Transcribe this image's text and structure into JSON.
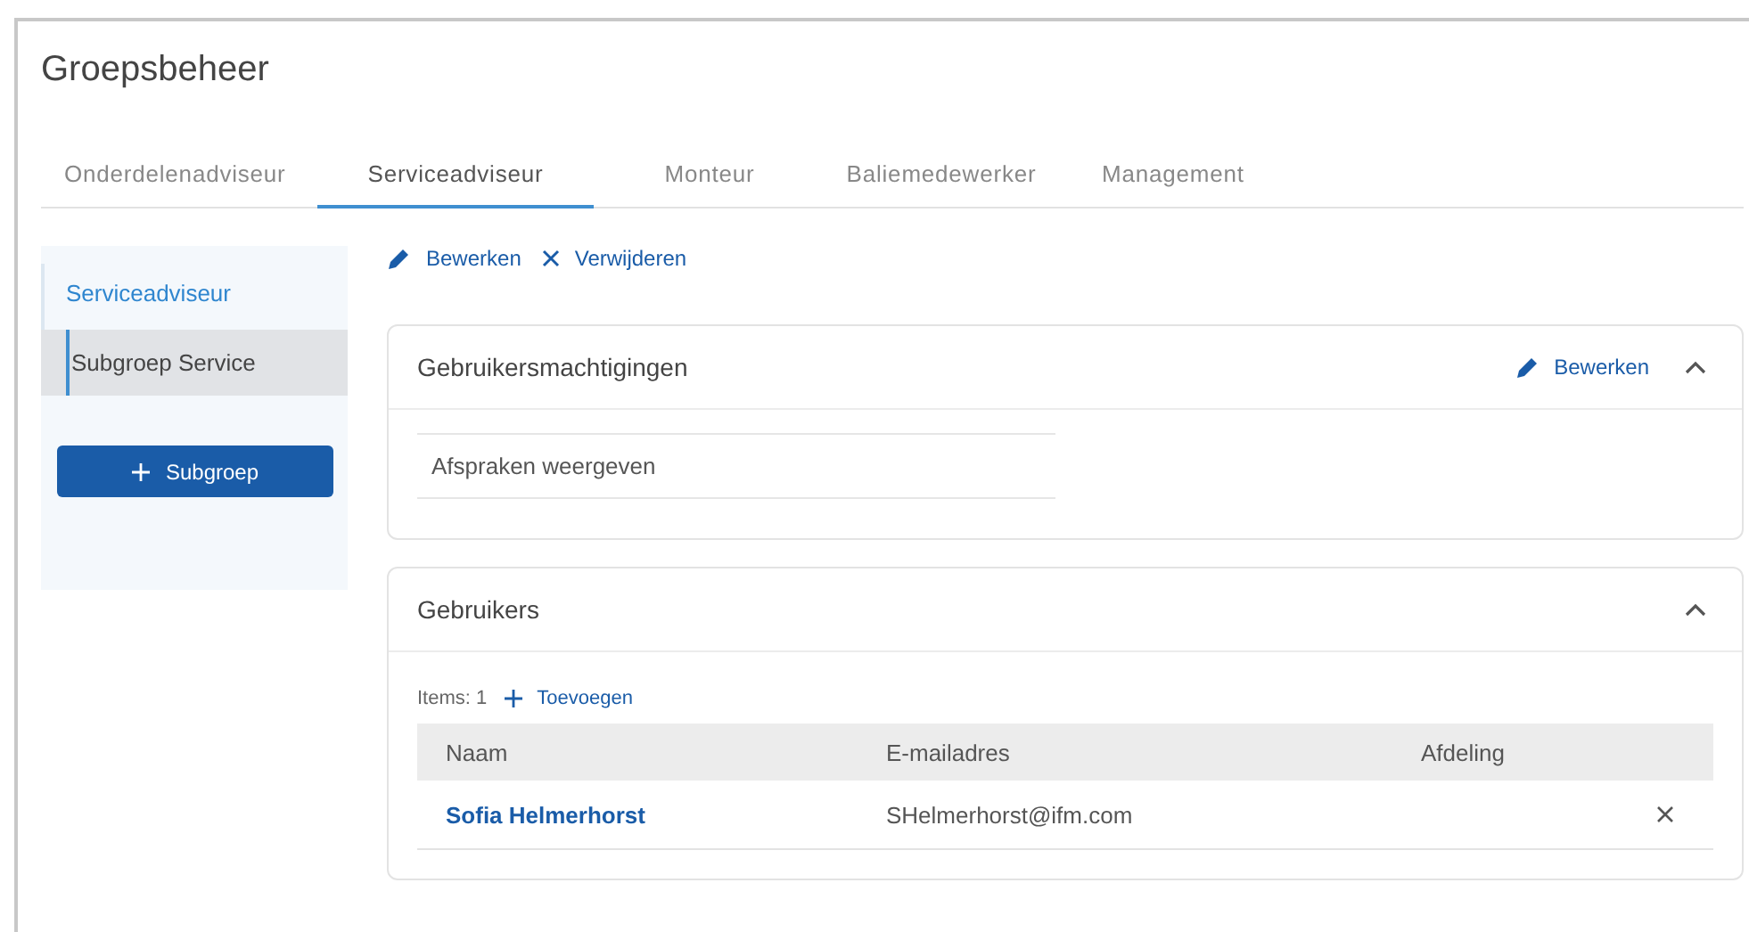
{
  "page": {
    "title": "Groepsbeheer"
  },
  "tabs": [
    {
      "label": "Onderdelenadviseur",
      "selected": false
    },
    {
      "label": "Serviceadviseur",
      "selected": true
    },
    {
      "label": "Monteur",
      "selected": false
    },
    {
      "label": "Baliemedewerker",
      "selected": false
    },
    {
      "label": "Management",
      "selected": false
    }
  ],
  "sidebar": {
    "groups": [
      {
        "label": "Serviceadviseur",
        "selected": false,
        "children": [
          {
            "label": "Subgroep Service",
            "selected": true
          }
        ]
      }
    ],
    "add_button": "Subgroep"
  },
  "actions": [
    "Bewerken",
    "Verwijderen"
  ],
  "permissions_panel": {
    "title": "Gebruikersmachtigingen",
    "edit": "Bewerken",
    "expanded": true,
    "items": [
      "Afspraken weergeven"
    ]
  },
  "users_panel": {
    "title": "Gebruikers",
    "expanded": true,
    "count": "Items: 1",
    "add": "Toevoegen",
    "columns": [
      "Naam",
      "E-mailadres",
      "Afdeling"
    ],
    "rows": [
      {
        "name": "Sofia Helmerhorst",
        "email": "SHelmerhorst@ifm.com"
      }
    ]
  }
}
